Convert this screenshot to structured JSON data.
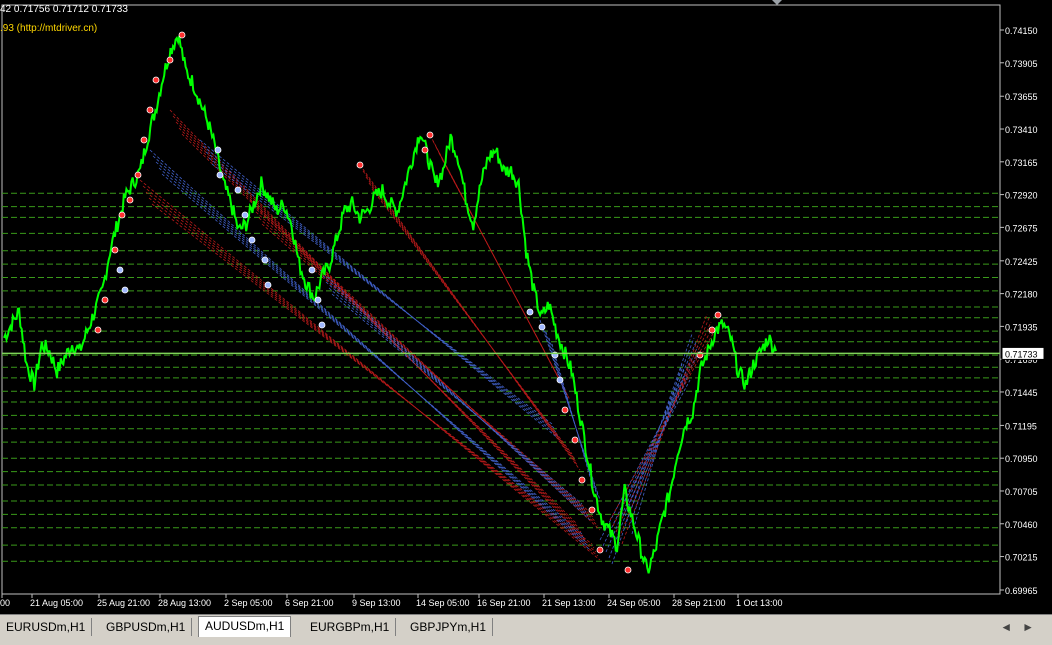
{
  "ohlc_readout": "42 0.71756 0.71712 0.71733",
  "indicator_label": ".93 (http://mtdriver.cn)",
  "current_price": "0.71733",
  "colors": {
    "candles": "#00ff00",
    "grid_lines": "#3a9a1a",
    "current_line": "#7fd35a",
    "buy_arrow": "#ff3030",
    "sell_arrow": "#a0b8ff",
    "red_lines": "#b81a1a",
    "blue_lines": "#4060c8"
  },
  "chart_data": {
    "type": "line",
    "symbol": "AUDUSDm,H1",
    "ylim": [
      0.69965,
      0.74275
    ],
    "y_ticks": [
      "0.74150",
      "0.73905",
      "0.73655",
      "0.73410",
      "0.73165",
      "0.72920",
      "0.72675",
      "0.72425",
      "0.72180",
      "0.71935",
      "0.71690",
      "0.71445",
      "0.71195",
      "0.70950",
      "0.70705",
      "0.70460",
      "0.70215",
      "0.69965"
    ],
    "x_ticks": [
      "00",
      "21 Aug 05:00",
      "25 Aug 21:00",
      "28 Aug 13:00",
      "2 Sep 05:00",
      "6 Sep 21:00",
      "9 Sep 13:00",
      "14 Sep 05:00",
      "16 Sep 21:00",
      "21 Sep 13:00",
      "24 Sep 05:00",
      "28 Sep 21:00",
      "1 Oct 13:00"
    ],
    "series": [
      {
        "values": [
          0.7185,
          0.7195,
          0.7205,
          0.7165,
          0.715,
          0.718,
          0.7175,
          0.716,
          0.717,
          0.718,
          0.7175,
          0.719,
          0.7205,
          0.722,
          0.725,
          0.727,
          0.729,
          0.73,
          0.731,
          0.7335,
          0.7355,
          0.738,
          0.74,
          0.7412,
          0.7385,
          0.7375,
          0.736,
          0.7345,
          0.7325,
          0.73,
          0.7285,
          0.7265,
          0.727,
          0.7285,
          0.73,
          0.729,
          0.728,
          0.7285,
          0.727,
          0.724,
          0.7225,
          0.7215,
          0.723,
          0.724,
          0.726,
          0.728,
          0.7285,
          0.7275,
          0.728,
          0.729,
          0.7295,
          0.7285,
          0.728,
          0.73,
          0.732,
          0.734,
          0.732,
          0.73,
          0.731,
          0.7335,
          0.732,
          0.729,
          0.727,
          0.73,
          0.732,
          0.7325,
          0.731,
          0.731,
          0.73,
          0.725,
          0.722,
          0.72,
          0.721,
          0.719,
          0.7175,
          0.716,
          0.713,
          0.71,
          0.707,
          0.705,
          0.704,
          0.703,
          0.707,
          0.705,
          0.703,
          0.701,
          0.7025,
          0.705,
          0.707,
          0.71,
          0.712,
          0.713,
          0.716,
          0.7175,
          0.719,
          0.7195,
          0.7185,
          0.716,
          0.715,
          0.7165,
          0.7175,
          0.7185,
          0.7175
        ]
      }
    ],
    "support_resistance_levels": [
      0.7293,
      0.7283,
      0.7275,
      0.7263,
      0.725,
      0.724,
      0.723,
      0.722,
      0.7208,
      0.72,
      0.719,
      0.7182,
      0.7172,
      0.7163,
      0.7155,
      0.7145,
      0.7137,
      0.7127,
      0.7117,
      0.7107,
      0.7095,
      0.7085,
      0.7075,
      0.7063,
      0.7053,
      0.7043,
      0.703,
      0.7018
    ],
    "grid": false
  },
  "tabs": [
    {
      "label": "EURUSDm,H1",
      "active": false
    },
    {
      "label": "GBPUSDm,H1",
      "active": false
    },
    {
      "label": "AUDUSDm,H1",
      "active": true
    },
    {
      "label": "EURGBPm,H1",
      "active": false
    },
    {
      "label": "GBPJPYm,H1",
      "active": false
    }
  ],
  "nav": {
    "left": "◄",
    "right": "►"
  }
}
